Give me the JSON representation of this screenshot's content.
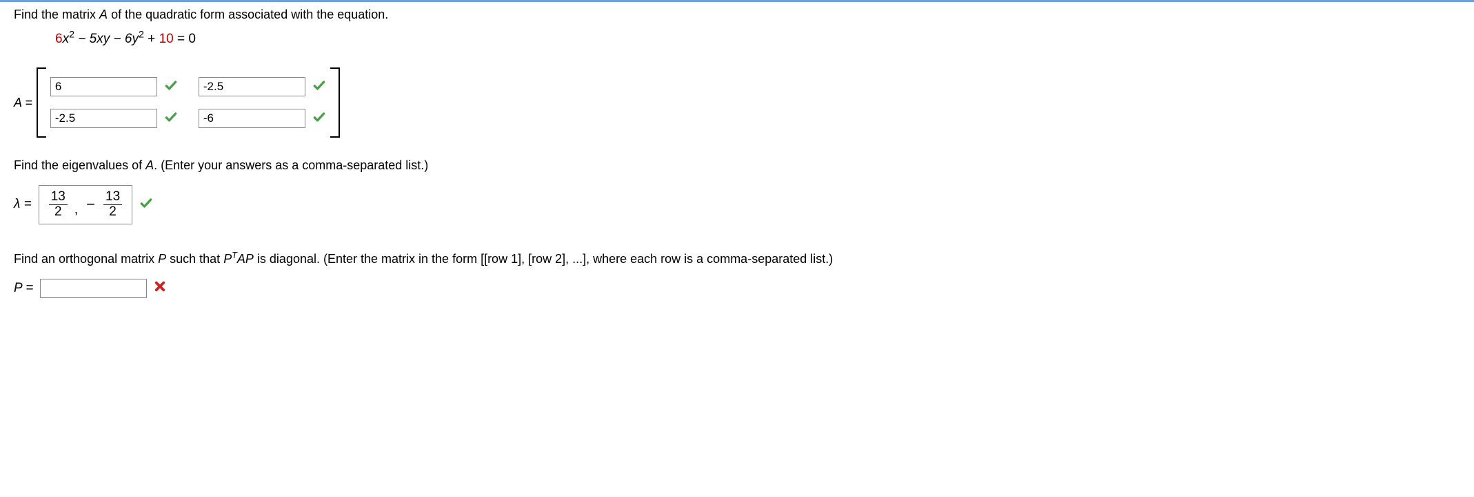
{
  "q1": {
    "prompt_prefix": "Find the matrix ",
    "prompt_var": "A",
    "prompt_suffix": " of the quadratic form associated with the equation.",
    "equation_red": "6",
    "equation_plain1": "x",
    "equation_sup1": "2",
    "equation_plain2": " − 5xy − 6y",
    "equation_sup2": "2",
    "equation_plain3": " + ",
    "equation_red2": "10",
    "equation_tail": " = 0"
  },
  "matrix": {
    "label": "A = ",
    "cells": {
      "a11": "6",
      "a12": "-2.5",
      "a21": "-2.5",
      "a22": "-6"
    }
  },
  "q2": {
    "prompt_prefix": "Find the eigenvalues of ",
    "prompt_var": "A",
    "prompt_suffix": ". (Enter your answers as a comma-separated list.)",
    "lambda_label": "λ = ",
    "frac1_num": "13",
    "frac1_den": "2",
    "comma": ",",
    "minus": "−",
    "frac2_num": "13",
    "frac2_den": "2"
  },
  "q3": {
    "prompt_prefix": "Find an orthogonal matrix ",
    "prompt_var": "P",
    "prompt_mid": " such that ",
    "prompt_ptap_p": "P",
    "prompt_ptap_t": "T",
    "prompt_ptap_ap": "AP",
    "prompt_suffix": " is diagonal. (Enter the matrix in the form [[row 1], [row 2], ...], where each row is a comma-separated list.)",
    "p_label": "P = ",
    "p_value": ""
  }
}
